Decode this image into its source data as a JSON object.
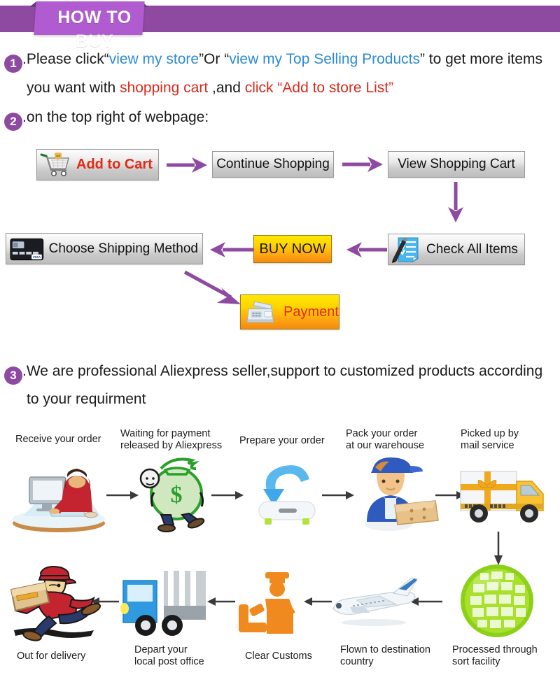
{
  "banner": {
    "title": "HOW TO BUY",
    "bar_color": "#8e4aa0",
    "ribbon_color": "#b05cd0"
  },
  "instructions": [
    {
      "number": "1",
      "line1_a": ".Please click“",
      "line1_link1": "view my store",
      "line1_b": "”Or “",
      "line1_link2": "view my Top Selling Products",
      "line1_c": "” to get more items",
      "line2_a": "you want with ",
      "line2_red1": "shopping cart",
      "line2_b": " ,and ",
      "line2_red2": "click “Add to store List”"
    },
    {
      "number": "2",
      "text": ".on the top right of webpage:"
    },
    {
      "number": "3",
      "line1": ".We are professional Aliexpress seller,support to customized products according",
      "line2": "to your requirment"
    }
  ],
  "flow": {
    "buttons": [
      {
        "id": "add-to-cart",
        "label": "Add to Cart",
        "icon": "shopping-cart-icon"
      },
      {
        "id": "continue-shopping",
        "label": "Continue Shopping",
        "icon": ""
      },
      {
        "id": "view-shopping-cart",
        "label": "View Shopping Cart",
        "icon": ""
      },
      {
        "id": "check-all-items",
        "label": "Check All Items",
        "icon": "checklist-icon"
      },
      {
        "id": "buy-now",
        "label": "BUY NOW",
        "icon": ""
      },
      {
        "id": "choose-shipping-method",
        "label": "Choose Shipping Method",
        "icon": "credit-card-icon"
      },
      {
        "id": "payment",
        "label": "Payment",
        "icon": "cash-register-icon"
      }
    ],
    "arrow_color": "#8e4aa0"
  },
  "shipping": {
    "top_row": [
      {
        "label": "Receive your order",
        "art": "person-at-computer-icon"
      },
      {
        "label": "Waiting for payment\nreleased by Aliexpress",
        "art": "money-bag-person-icon"
      },
      {
        "label": "Prepare your order",
        "art": "blue-download-arrow-icon"
      },
      {
        "label": "Pack your order\nat our warehouse",
        "art": "warehouse-worker-icon"
      },
      {
        "label": "Picked up by\nmail service",
        "art": "delivery-truck-gift-icon"
      }
    ],
    "bottom_row": [
      {
        "label": "Out for delivery",
        "art": "running-courier-icon"
      },
      {
        "label": "Depart your\nlocal post office",
        "art": "blue-post-truck-icon"
      },
      {
        "label": "Clear Customs",
        "art": "customs-officer-icon"
      },
      {
        "label": "Flown to destination\ncountry",
        "art": "airplane-icon"
      },
      {
        "label": "Processed through\nsort facility",
        "art": "green-globe-icon"
      }
    ],
    "arrow_color": "#3a3a3a"
  }
}
